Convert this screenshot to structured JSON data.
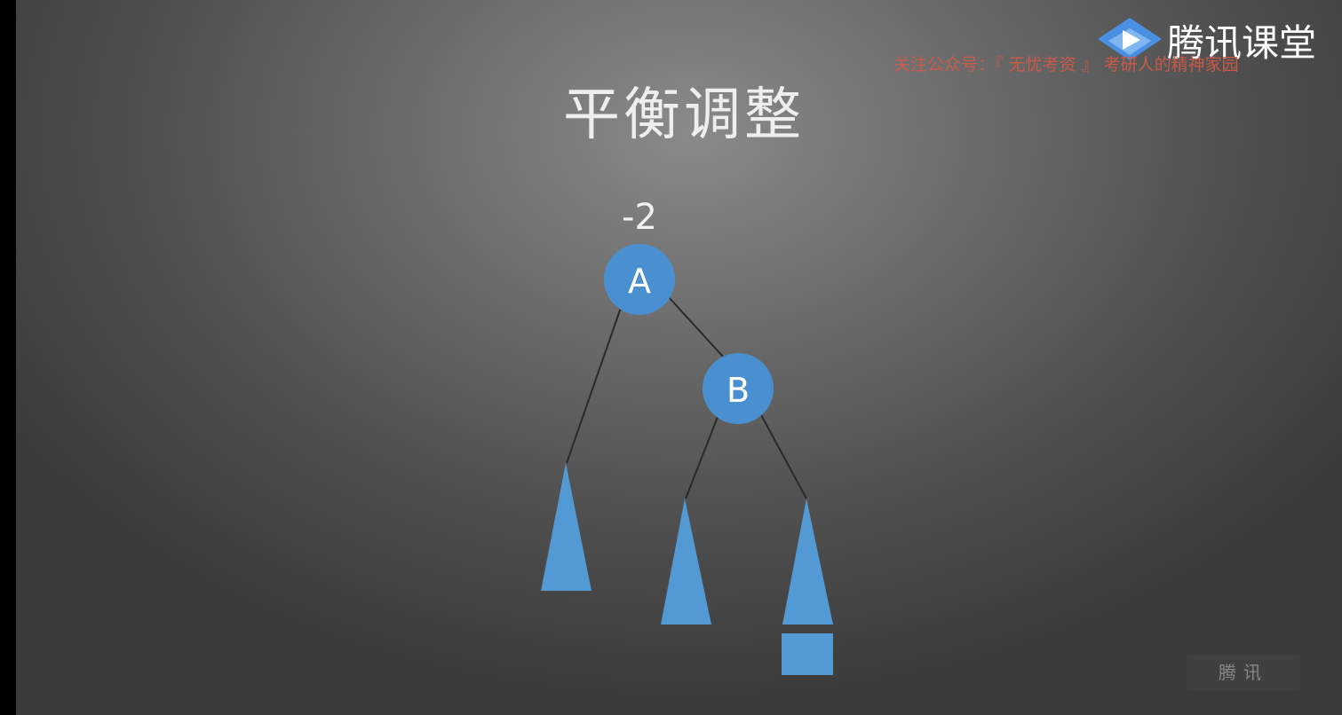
{
  "slide": {
    "title": "平衡调整",
    "balance_factor": "-2"
  },
  "tree": {
    "nodes": [
      {
        "id": "A",
        "label": "A"
      },
      {
        "id": "B",
        "label": "B"
      }
    ],
    "subtrees": [
      "A-left",
      "B-left",
      "B-right"
    ],
    "node_color": "#4a90d0",
    "subtree_color": "#5399d4",
    "edge_color": "#2a2a2a"
  },
  "brand": {
    "name": "腾讯课堂",
    "logo_icon": "play-icon"
  },
  "watermark": {
    "text": "关注公众号：『 无忧考资 』 考研人的精神家园"
  },
  "player_badge": {
    "text": "腾讯"
  }
}
